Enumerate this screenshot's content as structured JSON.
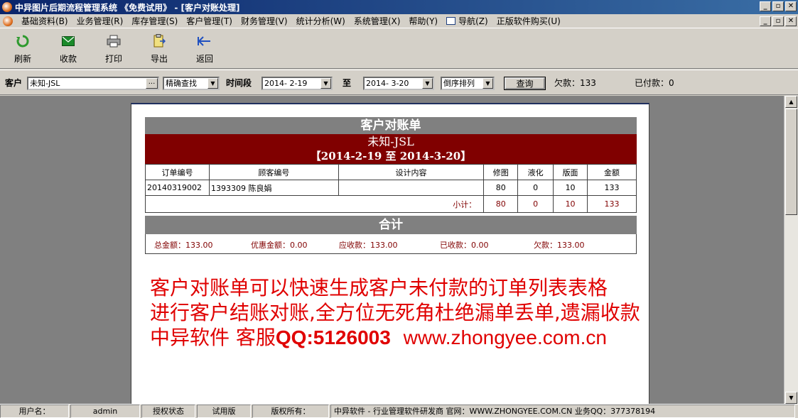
{
  "window": {
    "title": "中异图片后期流程管理系统 《免费试用》 - [客户对账处理]",
    "min_glyph": "_",
    "max_glyph": "▫",
    "close_glyph": "✕"
  },
  "menu": {
    "items": [
      "基础资料(B)",
      "业务管理(R)",
      "库存管理(S)",
      "客户管理(T)",
      "财务管理(V)",
      "统计分析(W)",
      "系统管理(X)",
      "帮助(Y)"
    ],
    "nav": "导航(Z)",
    "buy": "正版软件购买(U)"
  },
  "toolbar": {
    "refresh": "刷新",
    "receive": "收款",
    "print": "打印",
    "export": "导出",
    "back": "返回"
  },
  "filter": {
    "customer_label": "客户",
    "customer_value": "未知-JSL",
    "match_mode": "精确查找",
    "period_label": "时间段",
    "date_from": "2014- 2-19",
    "to_label": "至",
    "date_to": "2014- 3-20",
    "sort": "倒序排列",
    "query_button": "查询",
    "owed": "欠款：133",
    "paid": "已付款：0"
  },
  "statement": {
    "title": "客户对账单",
    "customer": "未知-JSL",
    "range": "【2014-2-19 至 2014-3-20】",
    "columns": [
      "订单编号",
      "顾客编号",
      "设计内容",
      "修图",
      "液化",
      "版面",
      "金额"
    ],
    "rows": [
      {
        "order": "20140319002",
        "client": "1393309 陈良娟",
        "design": "",
        "retouch": "80",
        "liquify": "0",
        "layout": "10",
        "amount": "133"
      }
    ],
    "subtotal": {
      "label": "小计：",
      "retouch": "80",
      "liquify": "0",
      "layout": "10",
      "amount": "133"
    },
    "total_title": "合计",
    "totals": {
      "total": "总金额：133.00",
      "discount": "优惠金额：0.00",
      "receivable": "应收款：133.00",
      "received": "已收款：0.00",
      "owed": "欠款：133.00"
    }
  },
  "promo": {
    "line1": "客户对账单可以快速生成客户未付款的订单列表表格",
    "line2": "进行客户结账对账,全方位无死角杜绝漏单丢单,遗漏收款",
    "line3_cn": "中异软件 客服",
    "line3_qq": "QQ:5126003",
    "line3_url": "www.zhongyee.com.cn"
  },
  "status": {
    "user_label": "用户名：",
    "user": "admin",
    "license_label": "授权状态",
    "license": "试用版",
    "copyright_label": "版权所有：",
    "copyright": "中异软件 - 行业管理软件研发商 官网：WWW.ZHONGYEE.COM.CN 业务QQ：377378194"
  },
  "colors": {
    "title_bar": "#0a246a",
    "header_red": "#800000",
    "promo_red": "#e00000",
    "header_gray": "#808080"
  }
}
